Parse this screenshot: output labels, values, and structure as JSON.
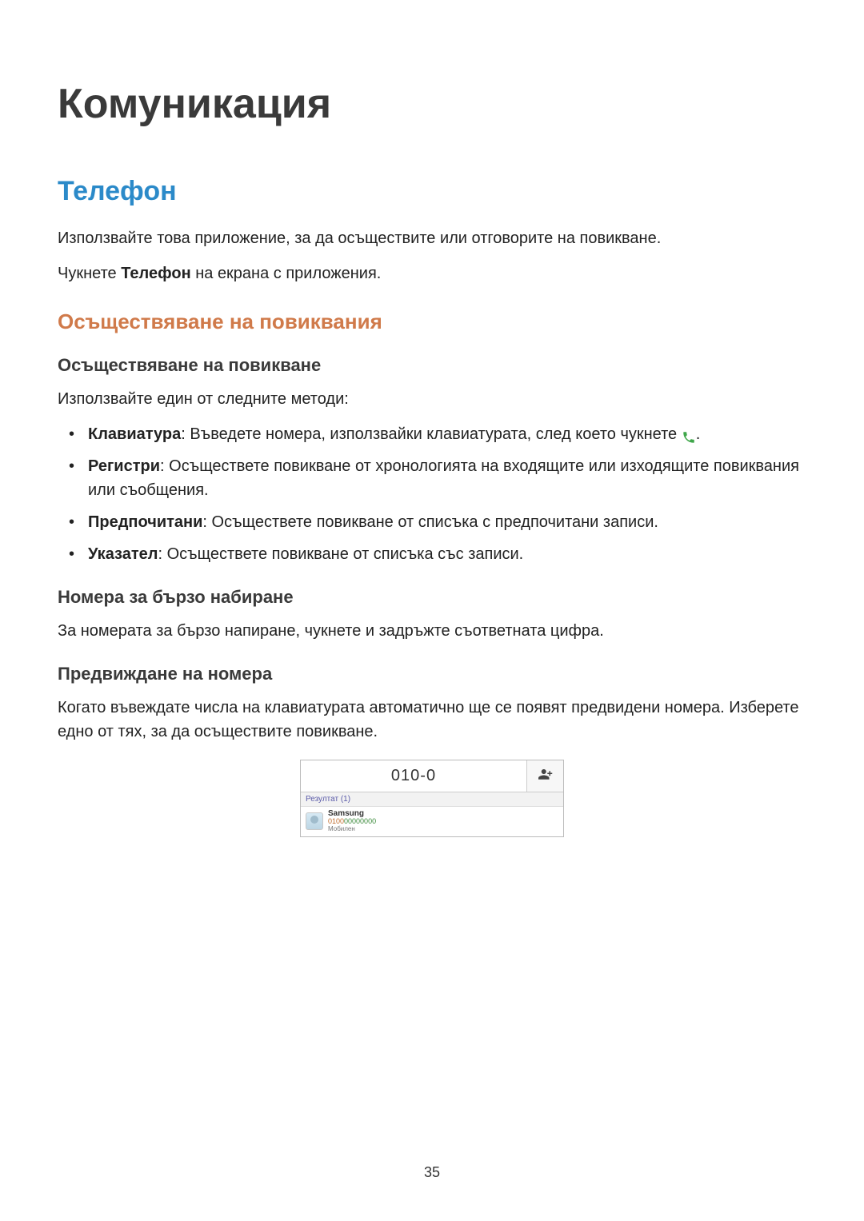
{
  "page_number": "35",
  "h1": "Комуникация",
  "h2": "Телефон",
  "intro_para": "Използвайте това приложение, за да осъществите или отговорите на повикване.",
  "tap_para_pre": "Чукнете ",
  "tap_para_bold": "Телефон",
  "tap_para_post": " на екрана с приложения.",
  "h3_calls": "Осъществяване на повиквания",
  "h4_make_call": "Осъществяване на повикване",
  "methods_intro": "Използвайте един от следните методи:",
  "bullets": {
    "b1_bold": "Клавиатура",
    "b1_rest": ": Въведете номера, използвайки клавиатурата, след което чукнете ",
    "b1_end": ".",
    "b2_bold": "Регистри",
    "b2_rest": ": Осъществете повикване от хронологията на входящите или изходящите повиквания или съобщения.",
    "b3_bold": "Предпочитани",
    "b3_rest": ": Осъществете повикване от списъка с предпочитани записи.",
    "b4_bold": "Указател",
    "b4_rest": ": Осъществете повикване от списъка със записи."
  },
  "h4_speed": "Номера за бързо набиране",
  "speed_para": "За номерата за бързо напиране, чукнете и задръжте съответната цифра.",
  "h4_predict": "Предвиждане на номера",
  "predict_para": "Когато въвеждате числа на клавиатурата автоматично ще се появят предвидени номера. Изберете едно от тях, за да осъществите повикване.",
  "figure": {
    "dialed": "010-0",
    "results_label": "Резултат (1)",
    "contact_name": "Samsung",
    "contact_number_match": "0100",
    "contact_number_rest": "00000000",
    "contact_type": "Мобилен",
    "icons": {
      "add_contact": "add-contact-icon",
      "call": "phone-icon"
    }
  }
}
